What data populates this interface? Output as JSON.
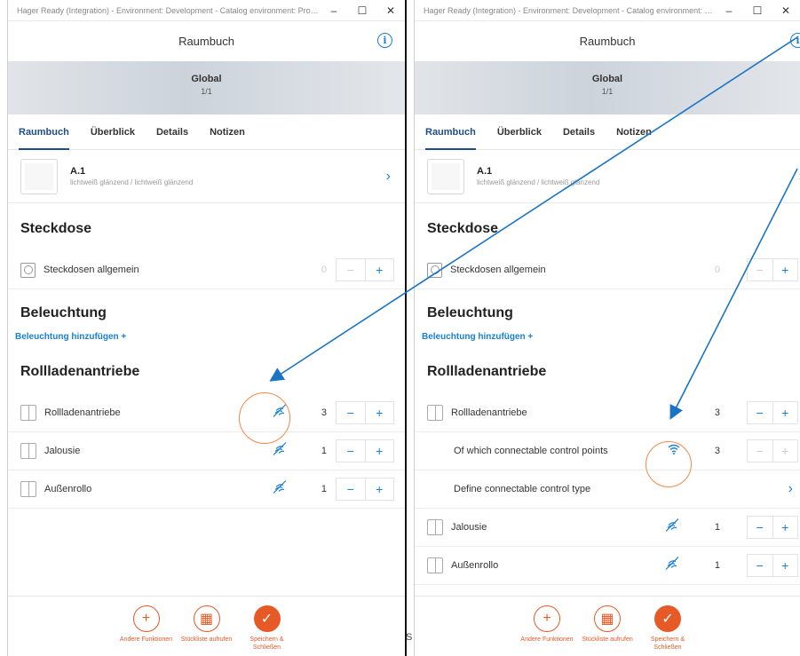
{
  "window": {
    "title": "Hager Ready (Integration) - Environment: Development - Catalog environment: Prod...",
    "minimize_glyph": "–",
    "maximize_glyph": "☐",
    "close_glyph": "✕"
  },
  "app": {
    "title": "Raumbuch",
    "info_glyph": "i"
  },
  "banner": {
    "title": "Global",
    "subtitle": "1/1"
  },
  "tabs": [
    {
      "label": "Raumbuch",
      "active": true
    },
    {
      "label": "Überblick",
      "active": false
    },
    {
      "label": "Details",
      "active": false
    },
    {
      "label": "Notizen",
      "active": false
    }
  ],
  "product": {
    "name": "A.1",
    "description": "lichtweiß glänzend / lichtweiß glänzend"
  },
  "sections": {
    "steckdose": "Steckdose",
    "beleuchtung": "Beleuchtung",
    "rollladen": "Rollladenantriebe"
  },
  "steckdose_row": {
    "label": "Steckdosen allgemein",
    "count": "0"
  },
  "add_light_link": "Beleuchtung hinzufügen +",
  "left_rows": [
    {
      "label": "Rollladenantriebe",
      "count": "3"
    },
    {
      "label": "Jalousie",
      "count": "1"
    },
    {
      "label": "Außenrollo",
      "count": "1"
    }
  ],
  "right_rows": {
    "rollladen": {
      "label": "Rollladenantriebe",
      "count": "3"
    },
    "connectable": {
      "label": "Of which connectable control points",
      "count": "3"
    },
    "define": {
      "label": "Define connectable control type"
    },
    "jalousie": {
      "label": "Jalousie",
      "count": "1"
    },
    "aussenrollo": {
      "label": "Außenrollo",
      "count": "1"
    }
  },
  "stepper": {
    "minus": "−",
    "plus": "+"
  },
  "chevron": "›",
  "bottom_actions": [
    {
      "label": "Andere Funktionen",
      "glyph": "+",
      "style": "outline"
    },
    {
      "label": "Stückliste aufrufen",
      "glyph": "▦",
      "style": "outline"
    },
    {
      "label": "Speichern & Schließen",
      "glyph": "✓",
      "style": "filled"
    }
  ],
  "between_text": "S",
  "colors": {
    "accent_blue": "#1a7fd0",
    "tab_active": "#1d4f86",
    "action_orange": "#e55a27",
    "highlight_circle": "#ef8a4a",
    "arrow": "#1a74c6"
  },
  "icons": {
    "socket": "socket-icon",
    "blind": "blind-icon",
    "no_connection": "unlinked-signal-icon",
    "wireless": "wifi-icon"
  }
}
